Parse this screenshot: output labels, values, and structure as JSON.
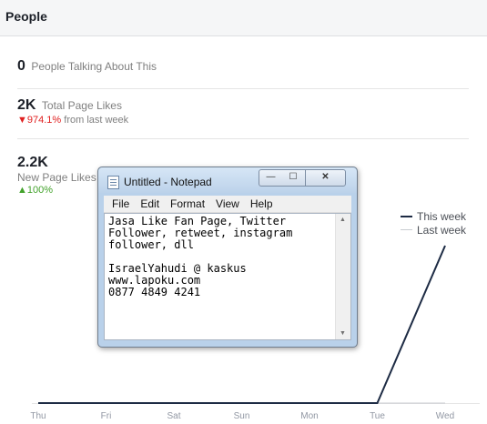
{
  "header": {
    "title": "People"
  },
  "stats": {
    "talking": {
      "value": "0",
      "label": "People Talking About This"
    },
    "total_likes": {
      "value": "2K",
      "label": "Total Page Likes",
      "change": "▼974.1%",
      "change_suffix": " from last week"
    },
    "new_likes": {
      "value": "2.2K",
      "label": "New Page Likes",
      "change": "▲100%"
    }
  },
  "legend": {
    "this_week": "This week",
    "last_week": "Last week"
  },
  "colors": {
    "this_week": "#1d2b44",
    "last_week": "#c9ccd1",
    "up": "#42a22b",
    "down": "#e02020"
  },
  "chart_data": {
    "type": "line",
    "categories": [
      "Thu",
      "Fri",
      "Sat",
      "Sun",
      "Mon",
      "Tue",
      "Wed"
    ],
    "series": [
      {
        "name": "This week",
        "values": [
          0,
          0,
          0,
          0,
          0,
          0,
          2200
        ]
      },
      {
        "name": "Last week",
        "values": [
          0,
          0,
          0,
          0,
          0,
          0,
          0
        ]
      }
    ],
    "ylim": [
      0,
      2200
    ],
    "legend": "right",
    "grid": false
  },
  "notepad": {
    "title": "Untitled - Notepad",
    "controls": {
      "minimize": "—",
      "maximize": "☐",
      "close": "✕"
    },
    "menu": [
      "File",
      "Edit",
      "Format",
      "View",
      "Help"
    ],
    "lines": [
      "Jasa Like Fan Page, Twitter",
      "Follower, retweet, instagram",
      "follower, dll",
      "",
      "IsraelYahudi @ kaskus",
      "www.lapoku.com",
      "0877 4849 4241"
    ]
  }
}
